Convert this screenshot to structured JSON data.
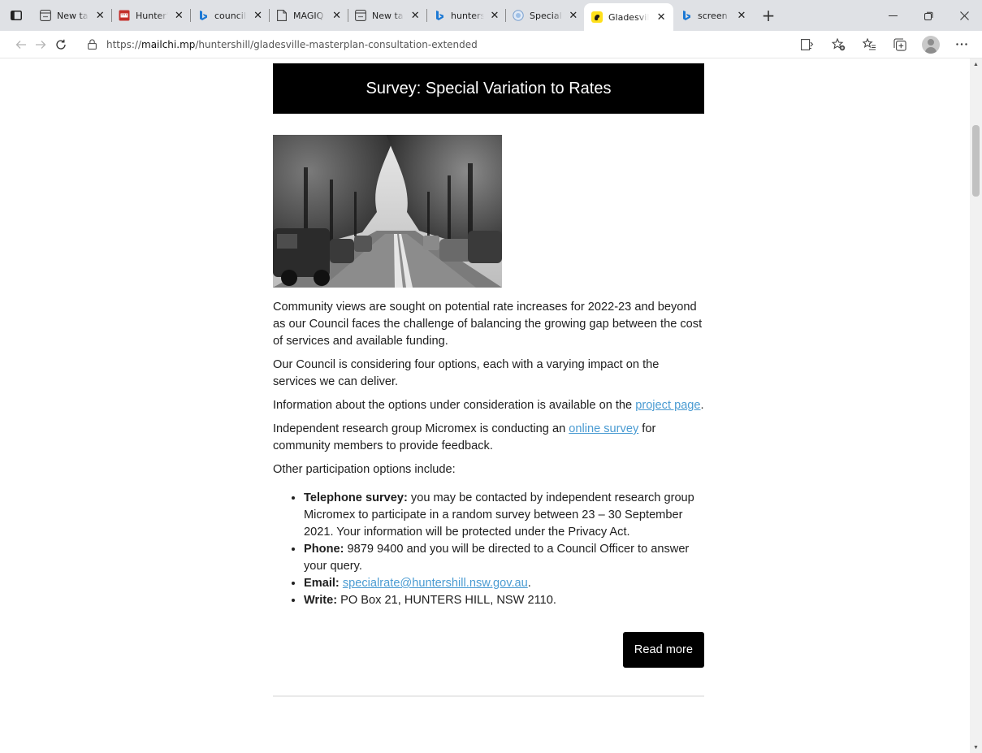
{
  "browser": {
    "tabs": [
      {
        "title": "New tab",
        "icon": "newtab-icon",
        "active": false
      },
      {
        "title": "Hunter's",
        "icon": "pdf-icon",
        "active": false
      },
      {
        "title": "council a",
        "icon": "bing-icon",
        "active": false
      },
      {
        "title": "MAGIQ D",
        "icon": "document-icon",
        "active": false
      },
      {
        "title": "New tab",
        "icon": "newtab-icon",
        "active": false
      },
      {
        "title": "hunters h",
        "icon": "bing-icon",
        "active": false
      },
      {
        "title": "Special V",
        "icon": "globe-icon",
        "active": false
      },
      {
        "title": "Gladesvil",
        "icon": "mailchimp-icon",
        "active": true
      },
      {
        "title": "screen sh",
        "icon": "bing-icon",
        "active": false
      }
    ],
    "url_prefix": "https://",
    "url_domain": "mailchi.mp",
    "url_path": "/huntershill/gladesville-masterplan-consultation-extended",
    "tab_close_glyph": "✕",
    "new_tab_glyph": "+"
  },
  "email": {
    "banner_title": "Survey: Special Variation to Rates",
    "paragraphs": {
      "p1": "Community views are sought on potential rate increases for 2022-23 and beyond as our Council faces the challenge of balancing the growing gap between the cost of services and available funding.",
      "p2": "Our Council is considering four options, each with a varying impact on the services we can deliver.",
      "p3_before": "Information about the options under consideration is available on the ",
      "p3_link": "project page",
      "p3_after": ".",
      "p4_before": "Independent research group Micromex is conducting an ",
      "p4_link": "online survey",
      "p4_after": " for community members to provide feedback.",
      "p5": "Other participation options include:"
    },
    "list": {
      "telephone_label": "Telephone survey:",
      "telephone_text": " you may be contacted by independent research group Micromex to participate in a random survey between 23 – 30 September 2021. Your information will be protected under the Privacy Act.",
      "phone_label": "Phone:",
      "phone_text": " 9879 9400 and you will be directed to a Council Officer to answer your query.",
      "email_label": "Email:",
      "email_link": "specialrate@huntershill.nsw.gov.au",
      "email_after": ".",
      "write_label": "Write:",
      "write_text": " PO Box 21, HUNTERS HILL, NSW 2110."
    },
    "read_more_label": "Read more"
  },
  "colors": {
    "banner_bg": "#000000",
    "link": "#4a9bd2",
    "tabstrip": "#dfe1e5"
  }
}
